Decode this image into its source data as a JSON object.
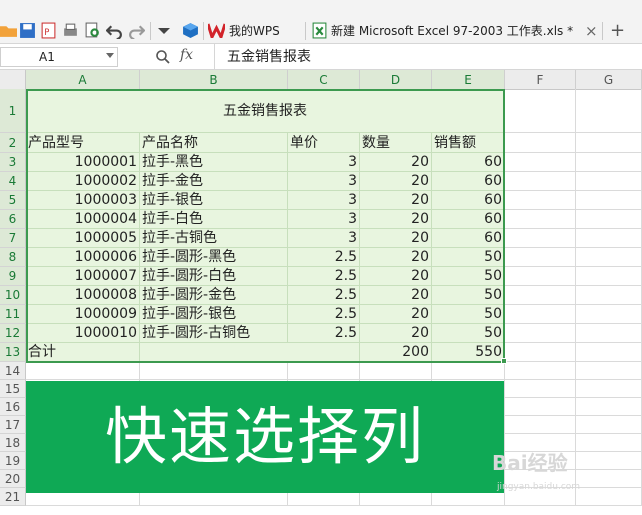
{
  "toolbar": {
    "tabs": [
      {
        "label": "我的WPS"
      },
      {
        "label": "新建 Microsoft Excel 97-2003 工作表.xls *"
      }
    ],
    "close_glyph": "×",
    "add_glyph": "+"
  },
  "formula_bar": {
    "name_box": "A1",
    "fx": "fx",
    "value": "五金销售报表"
  },
  "columns": [
    "A",
    "B",
    "C",
    "D",
    "E",
    "F",
    "G"
  ],
  "rows": [
    "1",
    "2",
    "3",
    "4",
    "5",
    "6",
    "7",
    "8",
    "9",
    "10",
    "11",
    "12",
    "13",
    "14",
    "15",
    "16",
    "17",
    "18",
    "19",
    "20",
    "21"
  ],
  "sheet": {
    "title": "五金销售报表",
    "headers": [
      "产品型号",
      "产品名称",
      "单价",
      "数量",
      "销售额"
    ],
    "data": [
      [
        "1000001",
        "拉手-黑色",
        "3",
        "20",
        "60"
      ],
      [
        "1000002",
        "拉手-金色",
        "3",
        "20",
        "60"
      ],
      [
        "1000003",
        "拉手-银色",
        "3",
        "20",
        "60"
      ],
      [
        "1000004",
        "拉手-白色",
        "3",
        "20",
        "60"
      ],
      [
        "1000005",
        "拉手-古铜色",
        "3",
        "20",
        "60"
      ],
      [
        "1000006",
        "拉手-圆形-黑色",
        "2.5",
        "20",
        "50"
      ],
      [
        "1000007",
        "拉手-圆形-白色",
        "2.5",
        "20",
        "50"
      ],
      [
        "1000008",
        "拉手-圆形-金色",
        "2.5",
        "20",
        "50"
      ],
      [
        "1000009",
        "拉手-圆形-银色",
        "2.5",
        "20",
        "50"
      ],
      [
        "1000010",
        "拉手-圆形-古铜色",
        "2.5",
        "20",
        "50"
      ]
    ],
    "total": [
      "合计",
      "",
      "",
      "200",
      "550"
    ]
  },
  "banner": {
    "text": "快速选择列",
    "color": "#0fa955"
  },
  "watermark": {
    "brand": "Bai经验",
    "url": "jingyan.baidu.com"
  },
  "icons": [
    "folder-icon",
    "save-icon",
    "export-pdf-icon",
    "print-icon",
    "print-preview-icon",
    "undo-icon",
    "redo-icon",
    "more-icon",
    "wps-cube-icon",
    "wps-logo-icon",
    "excel-file-icon",
    "zoom-icon"
  ]
}
